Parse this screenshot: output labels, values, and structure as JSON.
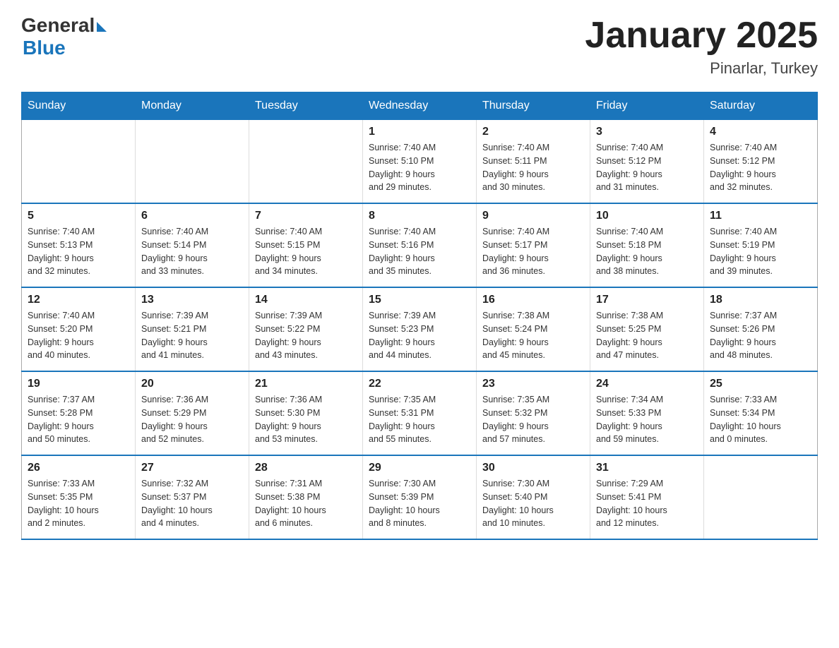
{
  "header": {
    "logo_general": "General",
    "logo_blue": "Blue",
    "title": "January 2025",
    "location": "Pinarlar, Turkey"
  },
  "days_of_week": [
    "Sunday",
    "Monday",
    "Tuesday",
    "Wednesday",
    "Thursday",
    "Friday",
    "Saturday"
  ],
  "weeks": [
    [
      {
        "day": "",
        "info": ""
      },
      {
        "day": "",
        "info": ""
      },
      {
        "day": "",
        "info": ""
      },
      {
        "day": "1",
        "info": "Sunrise: 7:40 AM\nSunset: 5:10 PM\nDaylight: 9 hours\nand 29 minutes."
      },
      {
        "day": "2",
        "info": "Sunrise: 7:40 AM\nSunset: 5:11 PM\nDaylight: 9 hours\nand 30 minutes."
      },
      {
        "day": "3",
        "info": "Sunrise: 7:40 AM\nSunset: 5:12 PM\nDaylight: 9 hours\nand 31 minutes."
      },
      {
        "day": "4",
        "info": "Sunrise: 7:40 AM\nSunset: 5:12 PM\nDaylight: 9 hours\nand 32 minutes."
      }
    ],
    [
      {
        "day": "5",
        "info": "Sunrise: 7:40 AM\nSunset: 5:13 PM\nDaylight: 9 hours\nand 32 minutes."
      },
      {
        "day": "6",
        "info": "Sunrise: 7:40 AM\nSunset: 5:14 PM\nDaylight: 9 hours\nand 33 minutes."
      },
      {
        "day": "7",
        "info": "Sunrise: 7:40 AM\nSunset: 5:15 PM\nDaylight: 9 hours\nand 34 minutes."
      },
      {
        "day": "8",
        "info": "Sunrise: 7:40 AM\nSunset: 5:16 PM\nDaylight: 9 hours\nand 35 minutes."
      },
      {
        "day": "9",
        "info": "Sunrise: 7:40 AM\nSunset: 5:17 PM\nDaylight: 9 hours\nand 36 minutes."
      },
      {
        "day": "10",
        "info": "Sunrise: 7:40 AM\nSunset: 5:18 PM\nDaylight: 9 hours\nand 38 minutes."
      },
      {
        "day": "11",
        "info": "Sunrise: 7:40 AM\nSunset: 5:19 PM\nDaylight: 9 hours\nand 39 minutes."
      }
    ],
    [
      {
        "day": "12",
        "info": "Sunrise: 7:40 AM\nSunset: 5:20 PM\nDaylight: 9 hours\nand 40 minutes."
      },
      {
        "day": "13",
        "info": "Sunrise: 7:39 AM\nSunset: 5:21 PM\nDaylight: 9 hours\nand 41 minutes."
      },
      {
        "day": "14",
        "info": "Sunrise: 7:39 AM\nSunset: 5:22 PM\nDaylight: 9 hours\nand 43 minutes."
      },
      {
        "day": "15",
        "info": "Sunrise: 7:39 AM\nSunset: 5:23 PM\nDaylight: 9 hours\nand 44 minutes."
      },
      {
        "day": "16",
        "info": "Sunrise: 7:38 AM\nSunset: 5:24 PM\nDaylight: 9 hours\nand 45 minutes."
      },
      {
        "day": "17",
        "info": "Sunrise: 7:38 AM\nSunset: 5:25 PM\nDaylight: 9 hours\nand 47 minutes."
      },
      {
        "day": "18",
        "info": "Sunrise: 7:37 AM\nSunset: 5:26 PM\nDaylight: 9 hours\nand 48 minutes."
      }
    ],
    [
      {
        "day": "19",
        "info": "Sunrise: 7:37 AM\nSunset: 5:28 PM\nDaylight: 9 hours\nand 50 minutes."
      },
      {
        "day": "20",
        "info": "Sunrise: 7:36 AM\nSunset: 5:29 PM\nDaylight: 9 hours\nand 52 minutes."
      },
      {
        "day": "21",
        "info": "Sunrise: 7:36 AM\nSunset: 5:30 PM\nDaylight: 9 hours\nand 53 minutes."
      },
      {
        "day": "22",
        "info": "Sunrise: 7:35 AM\nSunset: 5:31 PM\nDaylight: 9 hours\nand 55 minutes."
      },
      {
        "day": "23",
        "info": "Sunrise: 7:35 AM\nSunset: 5:32 PM\nDaylight: 9 hours\nand 57 minutes."
      },
      {
        "day": "24",
        "info": "Sunrise: 7:34 AM\nSunset: 5:33 PM\nDaylight: 9 hours\nand 59 minutes."
      },
      {
        "day": "25",
        "info": "Sunrise: 7:33 AM\nSunset: 5:34 PM\nDaylight: 10 hours\nand 0 minutes."
      }
    ],
    [
      {
        "day": "26",
        "info": "Sunrise: 7:33 AM\nSunset: 5:35 PM\nDaylight: 10 hours\nand 2 minutes."
      },
      {
        "day": "27",
        "info": "Sunrise: 7:32 AM\nSunset: 5:37 PM\nDaylight: 10 hours\nand 4 minutes."
      },
      {
        "day": "28",
        "info": "Sunrise: 7:31 AM\nSunset: 5:38 PM\nDaylight: 10 hours\nand 6 minutes."
      },
      {
        "day": "29",
        "info": "Sunrise: 7:30 AM\nSunset: 5:39 PM\nDaylight: 10 hours\nand 8 minutes."
      },
      {
        "day": "30",
        "info": "Sunrise: 7:30 AM\nSunset: 5:40 PM\nDaylight: 10 hours\nand 10 minutes."
      },
      {
        "day": "31",
        "info": "Sunrise: 7:29 AM\nSunset: 5:41 PM\nDaylight: 10 hours\nand 12 minutes."
      },
      {
        "day": "",
        "info": ""
      }
    ]
  ]
}
